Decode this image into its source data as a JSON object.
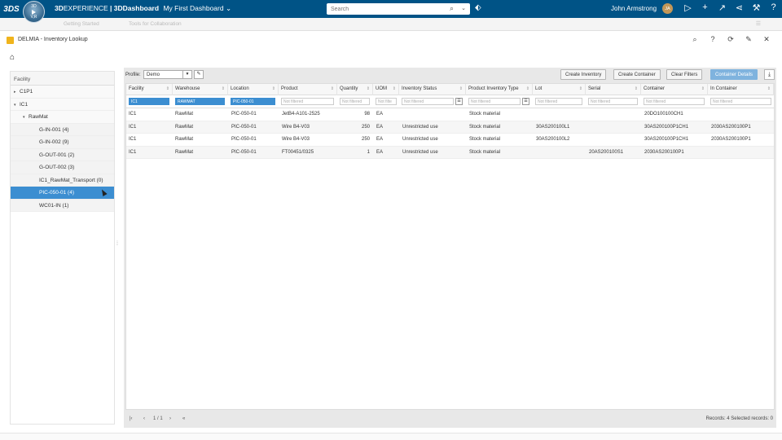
{
  "topbar": {
    "logo": "3DS",
    "compass_version": "V,R",
    "compass_left": "3D",
    "compass_right": "i",
    "brand_3d": "3D",
    "brand_experience": "EXPERIENCE",
    "brand_dashboard": "| 3DDashboard",
    "dashboard_name": "My First Dashboard",
    "search_placeholder": "Search",
    "user_name": "John Armstrong",
    "user_initials": "JA"
  },
  "tabbar": {
    "tab1": "Getting Started",
    "tab2": "Tools for Collaboration"
  },
  "app": {
    "title": "DELMIA - Inventory Lookup"
  },
  "left_panel": {
    "header": "Facility",
    "items": [
      {
        "label": "C1P1",
        "caret": "▸"
      },
      {
        "label": "IC1",
        "caret": "▾"
      },
      {
        "label": "RawMat",
        "caret": "▾"
      },
      {
        "label": "G-IN-001 (4)",
        "caret": ""
      },
      {
        "label": "G-IN-002 (9)",
        "caret": ""
      },
      {
        "label": "G-OUT-001 (2)",
        "caret": ""
      },
      {
        "label": "G-OUT-002 (3)",
        "caret": ""
      },
      {
        "label": "IC1_RawMat_Transport (0)",
        "caret": ""
      },
      {
        "label": "PIC-050-01 (4)",
        "caret": ""
      },
      {
        "label": "WC01-IN (1)",
        "caret": ""
      }
    ]
  },
  "toolbar": {
    "profile_label": "Profile:",
    "profile_value": "Demo",
    "create_inventory": "Create Inventory",
    "create_container": "Create Container",
    "clear_filters": "Clear Filters",
    "container_details": "Container Details"
  },
  "grid": {
    "columns": [
      "Facility",
      "Warehouse",
      "Location",
      "Product",
      "Quantity",
      "UOM",
      "Inventory Status",
      "Product Inventory Type",
      "Lot",
      "Serial",
      "Container",
      "In Container"
    ],
    "filters": [
      "IC1",
      "RAWMAT",
      "PIC-050-01",
      "Not filtered",
      "Not filtered",
      "Not filte",
      "Not filtered",
      "Not filtered",
      "Not filtered",
      "Not filtered",
      "Not filtered",
      "Not filtered"
    ],
    "rows": [
      [
        "IC1",
        "RawMat",
        "PIC-050-01",
        "JetB4-A101-2525",
        "98",
        "EA",
        "",
        "Stock material",
        "",
        "",
        "20DO100100CH1",
        ""
      ],
      [
        "IC1",
        "RawMat",
        "PIC-050-01",
        "Wire B4-V03",
        "250",
        "EA",
        "Unrestricted use",
        "Stock material",
        "30AS200100L1",
        "",
        "30AS200100P1CH1",
        "2030AS200100P1"
      ],
      [
        "IC1",
        "RawMat",
        "PIC-050-01",
        "Wire B4-V03",
        "250",
        "EA",
        "Unrestricted use",
        "Stock material",
        "30AS200100L2",
        "",
        "30AS200100P1CH1",
        "2030AS200100P1"
      ],
      [
        "IC1",
        "RawMat",
        "PIC-050-01",
        "FT00451/0325",
        "1",
        "EA",
        "Unrestricted use",
        "Stock material",
        "",
        "20AS200100S1",
        "2030AS200100P1",
        ""
      ]
    ]
  },
  "pager": {
    "page_info": "1 / 1",
    "records_text": "Records: 4  Selected records: 0"
  }
}
